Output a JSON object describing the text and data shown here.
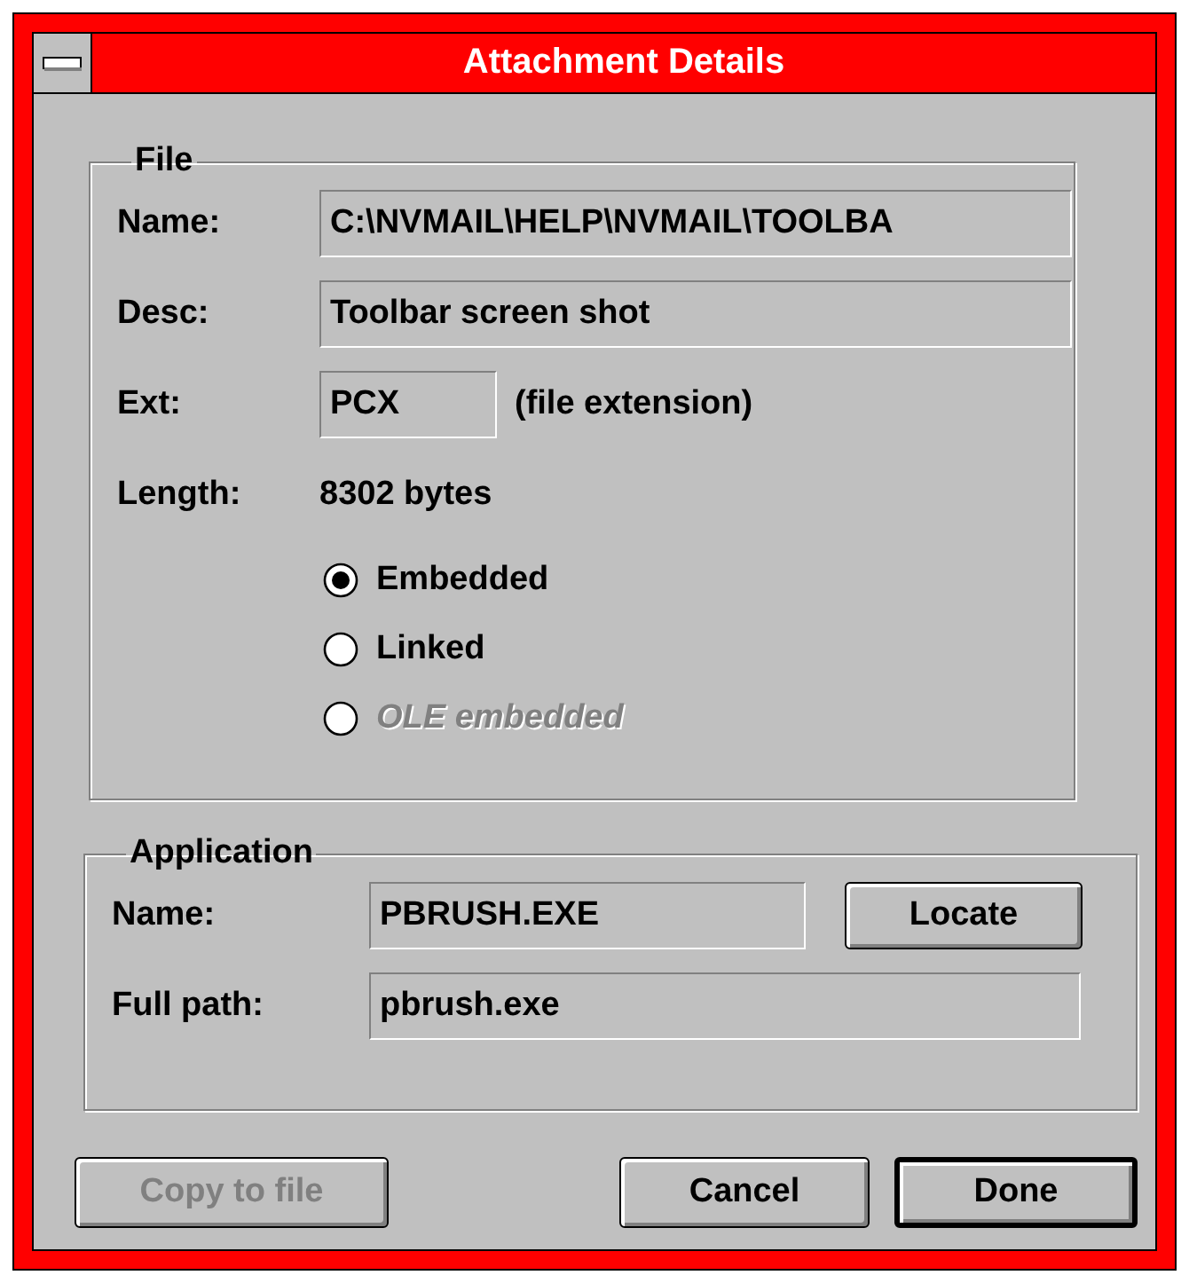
{
  "window": {
    "title": "Attachment Details"
  },
  "file_group": {
    "title": "File",
    "fields": [
      {
        "label": "Name:",
        "value": "C:\\NVMAIL\\HELP\\NVMAIL\\TOOLBA",
        "kind": "wide"
      },
      {
        "label": "Desc:",
        "value": "Toolbar screen shot",
        "kind": "wide"
      },
      {
        "label": "Ext:",
        "value": "PCX",
        "kind": "short",
        "note": "(file extension)"
      },
      {
        "label": "Length:",
        "value": "8302 bytes",
        "kind": "static"
      }
    ],
    "radios": [
      {
        "label": "Embedded",
        "selected": true,
        "disabled": false
      },
      {
        "label": "Linked",
        "selected": false,
        "disabled": false
      },
      {
        "label": "OLE embedded",
        "selected": false,
        "disabled": true
      }
    ]
  },
  "application_group": {
    "title": "Application",
    "name": {
      "label": "Name:",
      "value": "PBRUSH.EXE"
    },
    "locate_button": "Locate",
    "full_path": {
      "label": "Full path:",
      "value": "pbrush.exe"
    }
  },
  "buttons": [
    {
      "label": "Copy to file",
      "disabled": true,
      "default": false
    },
    {
      "label": "Cancel",
      "disabled": false,
      "default": false
    },
    {
      "label": "Done",
      "disabled": false,
      "default": true
    }
  ]
}
